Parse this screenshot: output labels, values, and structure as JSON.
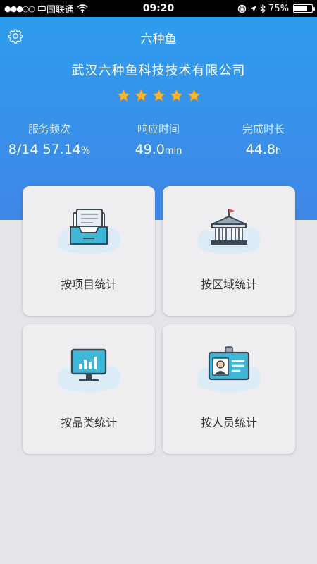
{
  "status_bar": {
    "carrier": "中国联通",
    "time": "09:20",
    "battery_text": "75%",
    "battery_level": 0.75,
    "signal_dots": "●●●○○"
  },
  "header": {
    "title": "六种鱼",
    "company": "武汉六种鱼科技技术有限公司",
    "rating": 5,
    "accent_color": "#2f9ded"
  },
  "stats": [
    {
      "label": "服务频次",
      "value": "8/14 57.14",
      "unit": "%"
    },
    {
      "label": "响应时间",
      "value": "49.0",
      "unit": "min"
    },
    {
      "label": "完成时长",
      "value": "44.8",
      "unit": "h"
    }
  ],
  "cards": [
    {
      "label": "按项目统计",
      "icon": "project-tray-icon"
    },
    {
      "label": "按区域统计",
      "icon": "building-icon"
    },
    {
      "label": "按品类统计",
      "icon": "monitor-chart-icon"
    },
    {
      "label": "按人员统计",
      "icon": "id-card-icon"
    }
  ]
}
